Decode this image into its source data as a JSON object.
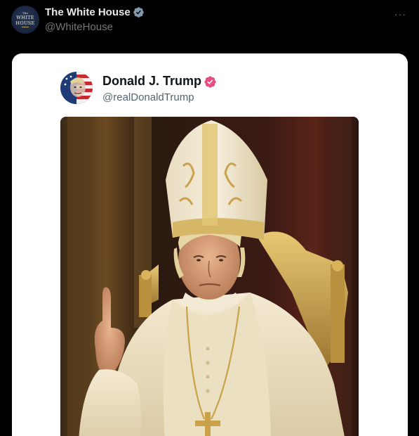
{
  "post": {
    "author_name": "The White House",
    "author_handle": "@WhiteHouse",
    "avatar_text": [
      "The",
      "WHITE",
      "HOUSE"
    ],
    "more_label": "···",
    "verified_color": "#829aab"
  },
  "embedded_post": {
    "author_name": "Donald J. Trump",
    "author_handle": "@realDonaldTrump",
    "verified_color": "#e84c85",
    "image_icon": "photo-ai-pope-portrait"
  },
  "colors": {
    "background": "#000000",
    "card": "#ffffff",
    "primary_text_dark": "#e7e9ea",
    "secondary_text_dark": "#71767b",
    "primary_text_light": "#0f1419",
    "secondary_text_light": "#536471"
  }
}
